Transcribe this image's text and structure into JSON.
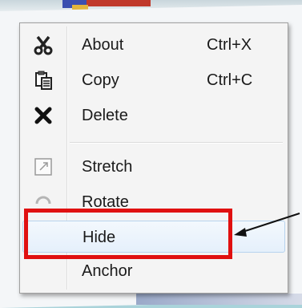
{
  "colors": {
    "menu_background": "#f4f4f4",
    "hover_background": "#e5f0fb",
    "callout_red": "#e01010",
    "backdrop_teal": "#a9d3da"
  },
  "menu": {
    "items": [
      {
        "label": "About",
        "shortcut": "Ctrl+X",
        "icon": "scissors-icon"
      },
      {
        "label": "Copy",
        "shortcut": "Ctrl+C",
        "icon": "copy-clipboard-icon"
      },
      {
        "label": "Delete",
        "shortcut": "",
        "icon": "delete-x-icon"
      },
      {
        "label": "Stretch",
        "shortcut": "",
        "icon": "stretch-icon"
      },
      {
        "label": "Rotate",
        "shortcut": "",
        "icon": "rotate-icon"
      },
      {
        "label": "Hide",
        "shortcut": "",
        "icon": ""
      },
      {
        "label": "Anchor",
        "shortcut": "",
        "icon": ""
      }
    ],
    "highlighted_item": "Hide"
  }
}
